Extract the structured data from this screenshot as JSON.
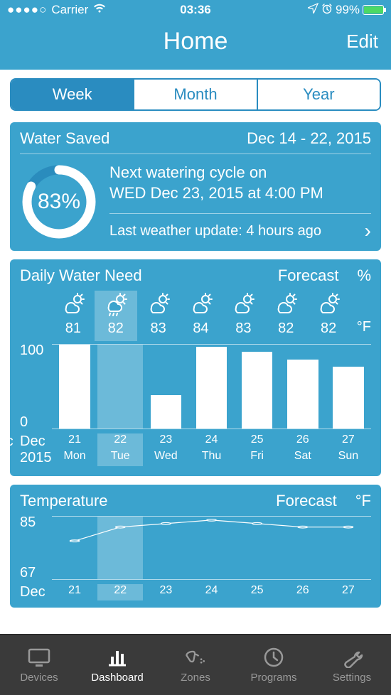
{
  "status": {
    "carrier": "Carrier",
    "time": "03:36",
    "battery_pct": "99%",
    "battery_fill": 99
  },
  "nav": {
    "title": "Home",
    "edit": "Edit"
  },
  "segments": {
    "items": [
      "Week",
      "Month",
      "Year"
    ],
    "selected": 0
  },
  "water_saved": {
    "title": "Water Saved",
    "range": "Dec 14 - 22, 2015",
    "pct": "83%",
    "pct_num": 83,
    "next_line1": "Next watering cycle on",
    "next_line2": "WED Dec 23, 2015 at 4:00 PM",
    "update": "Last weather update: 4 hours ago"
  },
  "daily_need": {
    "title": "Daily Water Need",
    "forecast_label": "Forecast",
    "pct_label": "%",
    "unit_label": "°F",
    "y_max": "100",
    "y_min": "0",
    "month": "Dec",
    "year": "2015",
    "today_index": 1,
    "days": [
      {
        "num": "21",
        "dow": "Mon",
        "temp": "81",
        "bar": 100,
        "icon": "partly"
      },
      {
        "num": "22",
        "dow": "Tue",
        "temp": "82",
        "bar": 0,
        "icon": "rain"
      },
      {
        "num": "23",
        "dow": "Wed",
        "temp": "83",
        "bar": 40,
        "icon": "partly"
      },
      {
        "num": "24",
        "dow": "Thu",
        "temp": "84",
        "bar": 98,
        "icon": "partly"
      },
      {
        "num": "25",
        "dow": "Fri",
        "temp": "83",
        "bar": 92,
        "icon": "partly"
      },
      {
        "num": "26",
        "dow": "Sat",
        "temp": "82",
        "bar": 82,
        "icon": "partly"
      },
      {
        "num": "27",
        "dow": "Sun",
        "temp": "82",
        "bar": 74,
        "icon": "partly"
      }
    ]
  },
  "temperature": {
    "title": "Temperature",
    "forecast_label": "Forecast",
    "unit_label": "°F",
    "y_max": "85",
    "y_min": "67",
    "month": "Dec",
    "today_index": 1,
    "days": [
      {
        "num": "21",
        "val": 78
      },
      {
        "num": "22",
        "val": 82
      },
      {
        "num": "23",
        "val": 83
      },
      {
        "num": "24",
        "val": 84
      },
      {
        "num": "25",
        "val": 83
      },
      {
        "num": "26",
        "val": 82
      },
      {
        "num": "27",
        "val": 82
      }
    ]
  },
  "tabs": {
    "items": [
      "Devices",
      "Dashboard",
      "Zones",
      "Programs",
      "Settings"
    ],
    "selected": 1
  },
  "chart_data": [
    {
      "type": "bar",
      "title": "Daily Water Need",
      "categories": [
        "Dec 21",
        "Dec 22",
        "Dec 23",
        "Dec 24",
        "Dec 25",
        "Dec 26",
        "Dec 27"
      ],
      "values": [
        100,
        0,
        40,
        98,
        92,
        82,
        74
      ],
      "ylabel": "%",
      "ylim": [
        0,
        100
      ]
    },
    {
      "type": "line",
      "title": "Temperature Forecast",
      "categories": [
        "Dec 21",
        "Dec 22",
        "Dec 23",
        "Dec 24",
        "Dec 25",
        "Dec 26",
        "Dec 27"
      ],
      "values": [
        78,
        82,
        83,
        84,
        83,
        82,
        82
      ],
      "ylabel": "°F",
      "ylim": [
        67,
        85
      ]
    }
  ]
}
